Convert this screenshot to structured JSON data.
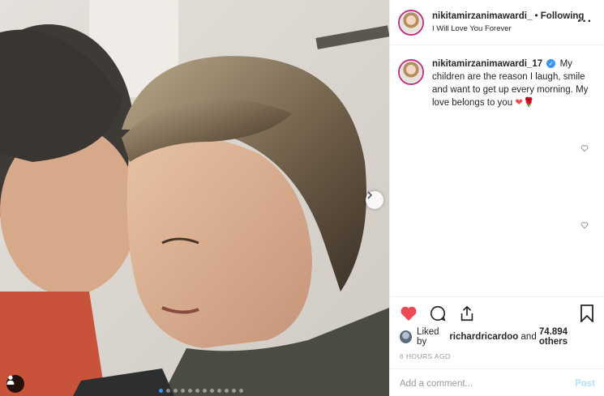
{
  "post": {
    "media_dots_total": 12,
    "media_dots_active_index": 0
  },
  "header": {
    "username": "nikitamirzanimawardi_",
    "separator": " • ",
    "follow_label": "Following",
    "subtitle": "I Will Love You Forever",
    "more_label": "···"
  },
  "caption": {
    "username": "nikitamirzanimawardi_17",
    "verified_glyph": "✓",
    "text": "My children are the reason I laugh, smile and want to get up every morning. My love belongs to you",
    "emoji": "❤🌹"
  },
  "likes": {
    "prefix": "Liked by ",
    "user": "richardricardoo",
    "middle": " and ",
    "count": "74.894 others"
  },
  "timestamp": "6 HOURS AGO",
  "comment_box": {
    "placeholder": "Add a comment...",
    "post_label": "Post"
  },
  "colors": {
    "liked_heart": "#ed4956",
    "link_blue": "#3897f0",
    "post_disabled": "#b2dffc"
  },
  "icons": [
    "next-arrow-icon",
    "user-tag-icon",
    "heart-icon",
    "comment-icon",
    "share-icon",
    "bookmark-icon",
    "verified-icon"
  ]
}
